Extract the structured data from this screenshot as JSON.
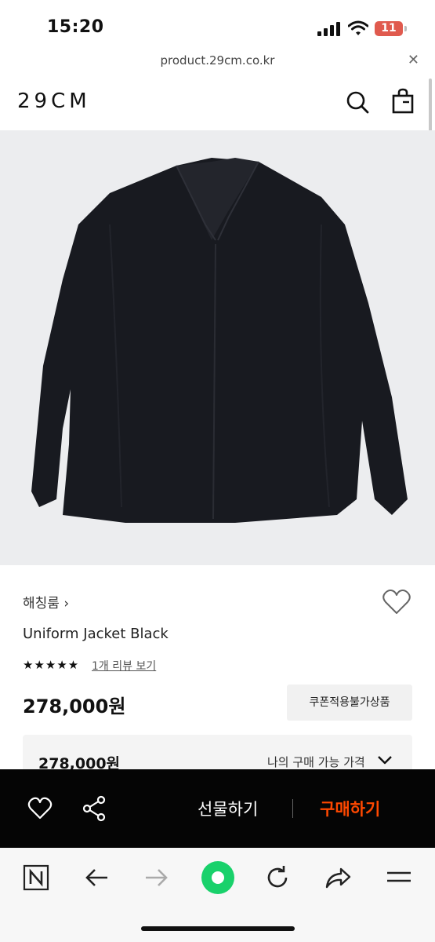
{
  "status": {
    "time": "15:20",
    "battery": "11"
  },
  "browser": {
    "url": "product.29cm.co.kr",
    "close_icon": "close-icon"
  },
  "header": {
    "logo": "29CM",
    "icons": [
      "search-icon",
      "shopping-bag-icon"
    ]
  },
  "product": {
    "brand": "해칭룸 ›",
    "name": "Uniform Jacket Black",
    "rating_stars": "★★★★★",
    "review_link": "1개 리뷰 보기",
    "price": "278,000원",
    "coupon_label": "쿠폰적용불가상품"
  },
  "price_box": {
    "price": "278,000원",
    "label": "나의 구매 가능 가격"
  },
  "buy_bar": {
    "gift_label": "선물하기",
    "buy_label": "구매하기",
    "accent": "#ff4800"
  },
  "toolbar": {
    "icons": [
      "n-home-icon",
      "back-arrow-icon",
      "forward-arrow-icon",
      "green-dot-icon",
      "reload-icon",
      "share-arrow-icon",
      "menu-icon"
    ]
  }
}
